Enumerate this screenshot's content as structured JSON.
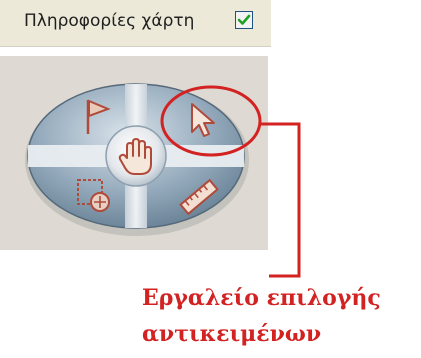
{
  "map_info": {
    "label": "Πληροφορίες χάρτη",
    "checked": true
  },
  "navigation_tools": [
    {
      "name": "flag-icon",
      "tool": "flag"
    },
    {
      "name": "select-arrow-icon",
      "tool": "select"
    },
    {
      "name": "hand-pan-icon",
      "tool": "pan"
    },
    {
      "name": "area-select-icon",
      "tool": "area-select"
    },
    {
      "name": "ruler-icon",
      "tool": "measure"
    }
  ],
  "annotation": {
    "color": "#d32222",
    "text_line1": "Εργαλείο επιλογής",
    "text_line2": "αντικειμένων"
  }
}
